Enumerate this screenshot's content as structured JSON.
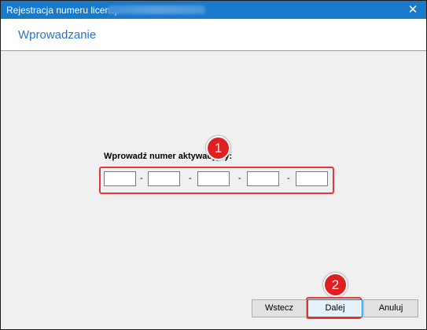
{
  "window": {
    "title": "Rejestracja numeru licencji",
    "close_glyph": "✕"
  },
  "header": {
    "title": "Wprowadzanie"
  },
  "form": {
    "prompt": "Wprowadź numer aktywacyjny:",
    "fields": [
      "",
      "",
      "",
      "",
      ""
    ],
    "separator": "-"
  },
  "annotations": {
    "badge1": "1",
    "badge2": "2"
  },
  "buttons": {
    "back": "Wstecz",
    "next": "Dalej",
    "cancel": "Anuluj"
  },
  "colors": {
    "titlebar": "#1979ca",
    "header_text": "#2b73c4",
    "callout_red": "#e23a3a"
  }
}
